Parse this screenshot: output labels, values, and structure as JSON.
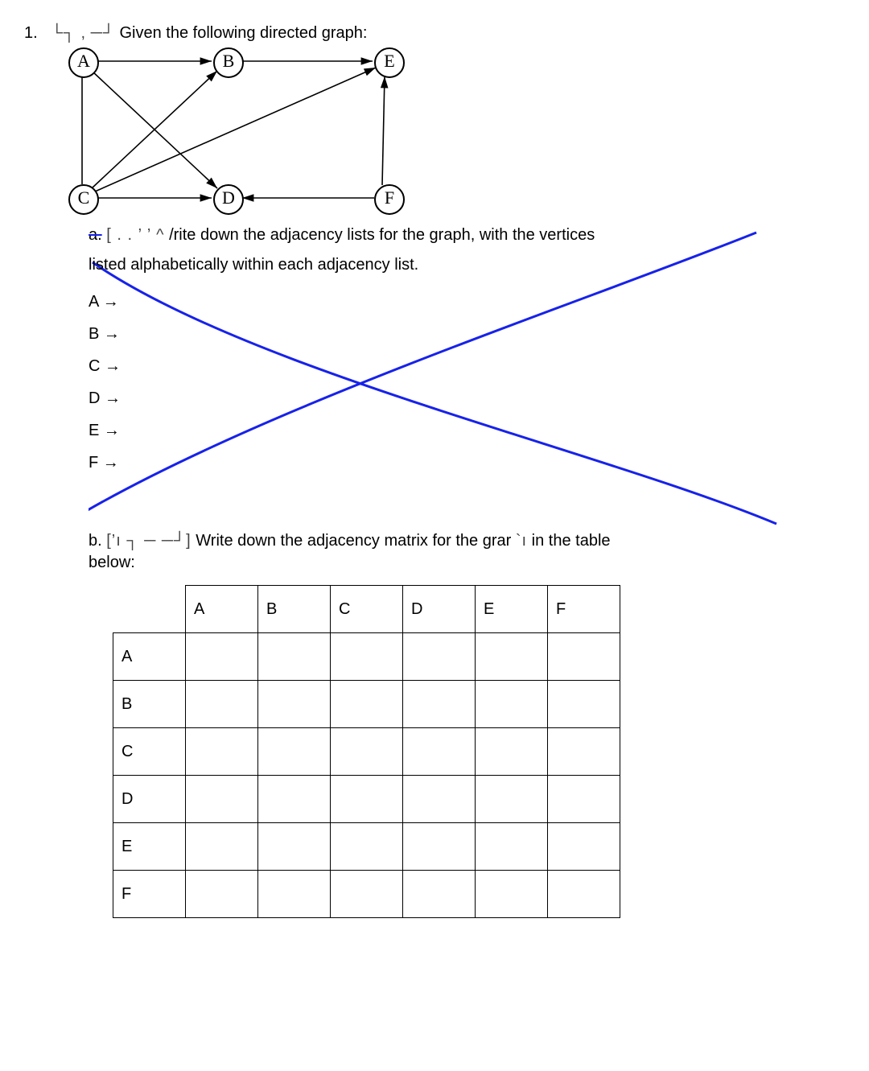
{
  "question": {
    "number": "1.",
    "obscured1": "└┐ ,",
    "obscured2": "─┘",
    "intro": "Given the following directed graph:"
  },
  "graph": {
    "nodes": {
      "A": "A",
      "B": "B",
      "C": "C",
      "D": "D",
      "E": "E",
      "F": "F"
    },
    "edges": [
      [
        "A",
        "B"
      ],
      [
        "B",
        "E"
      ],
      [
        "C",
        "B"
      ],
      [
        "C",
        "D"
      ],
      [
        "A",
        "C"
      ],
      [
        "A",
        "D"
      ],
      [
        "C",
        "E"
      ],
      [
        "F",
        "D"
      ],
      [
        "F",
        "E"
      ]
    ]
  },
  "partA": {
    "label_prefix": "a.",
    "obscured": "[ . .      ’ ’ ^",
    "text1": "/rite down the adjacency lists for the graph, with the vertices",
    "text2": "listed alphabetically within each adjacency list.",
    "list": {
      "A": "A →",
      "B": "B →",
      "C": "C →",
      "D": "D →",
      "E": "E →",
      "F": "F →"
    },
    "crossed_out": true
  },
  "partB": {
    "label_prefix": "b.",
    "obscured": "[’ı  ┐ ─  ─┘]",
    "text1": "Write down the adjacency matrix for the grar",
    "obscured2": "`ı",
    "text2": "in the table",
    "text3": "below:"
  },
  "matrix": {
    "headers": [
      "A",
      "B",
      "C",
      "D",
      "E",
      "F"
    ],
    "rows": [
      "A",
      "B",
      "C",
      "D",
      "E",
      "F"
    ]
  }
}
